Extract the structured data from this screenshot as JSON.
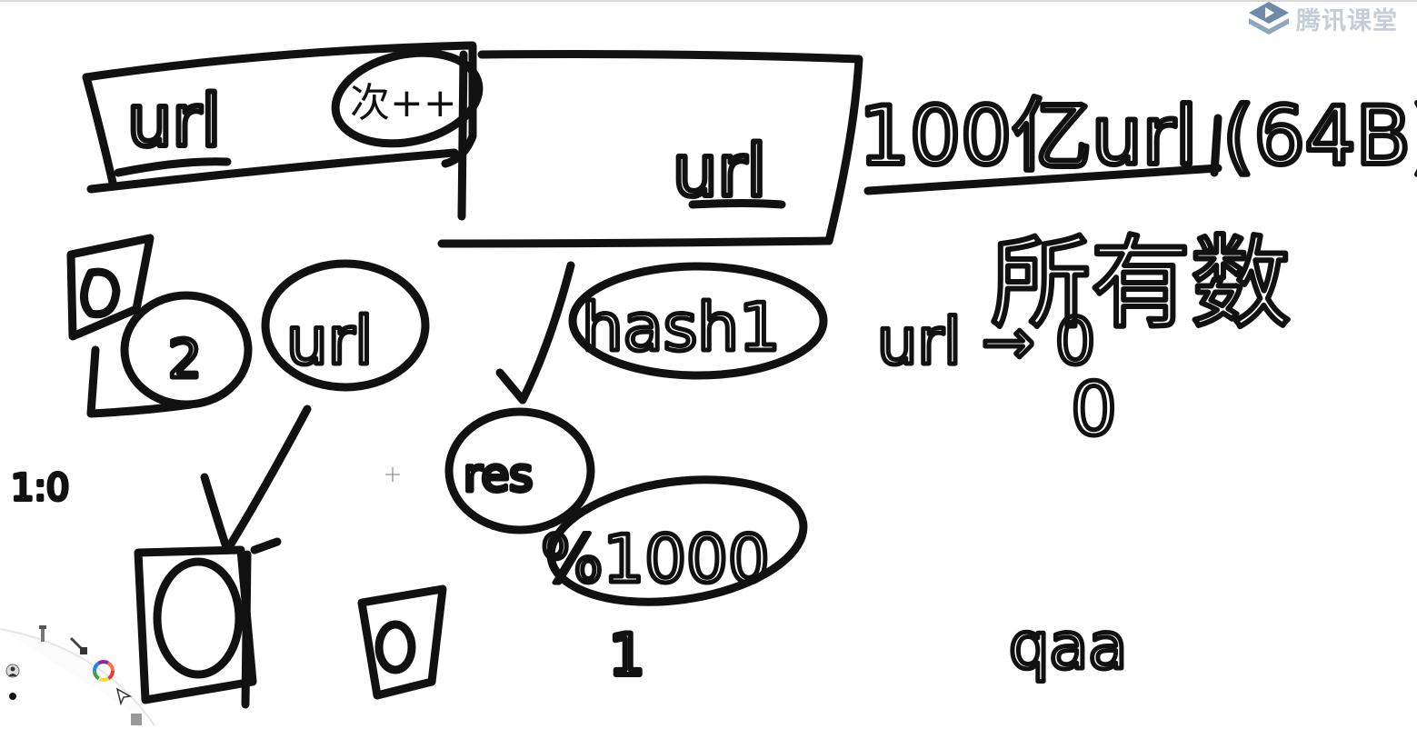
{
  "watermark": {
    "brand_text": "腾讯课堂",
    "logo_icon": "tencent-classroom-logo",
    "color": "#c6cdd6"
  },
  "whiteboard": {
    "ink_color": "#111111",
    "handwriting": {
      "box1_label": "url",
      "box1_counter": "次++",
      "box2_label": "url",
      "problem_statement": "100亿url (64B)",
      "constraint": "所有数",
      "url_node": "url",
      "hash_node": "hash1",
      "modulo_node": "%1000",
      "result_node": "res",
      "mapping": "url → 0",
      "note": "qaa",
      "digit_one": "1",
      "digit_zero_small": "0",
      "ratio": "1:0",
      "digit_two_node": "2"
    }
  },
  "tools": {
    "items": [
      {
        "icon": "move-tool-icon"
      },
      {
        "icon": "brush-icon"
      },
      {
        "icon": "color-wheel-icon"
      },
      {
        "icon": "select-pointer-icon"
      },
      {
        "icon": "eraser-icon"
      },
      {
        "icon": "person-icon"
      },
      {
        "icon": "dot-icon"
      }
    ]
  }
}
